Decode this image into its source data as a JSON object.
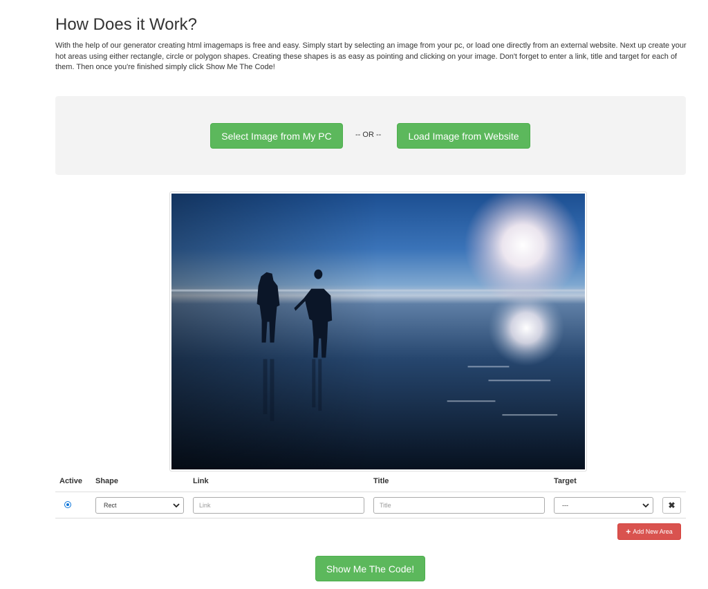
{
  "header": {
    "title": "How Does it Work?",
    "intro": "With the help of our generator creating html imagemaps is free and easy. Simply start by selecting an image from your pc, or load one directly from an external website. Next up create your hot areas using either rectangle, circle or polygon shapes. Creating these shapes is as easy as pointing and clicking on your image. Don't forget to enter a link, title and target for each of them. Then once you're finished simply click Show Me The Code!"
  },
  "upload": {
    "select_label": "Select Image from My PC",
    "or_label": "-- OR --",
    "load_label": "Load Image from Website"
  },
  "areas_table": {
    "headers": {
      "active": "Active",
      "shape": "Shape",
      "link": "Link",
      "title": "Title",
      "target": "Target"
    },
    "rows": [
      {
        "active": true,
        "shape": "Rect",
        "link_placeholder": "Link",
        "title_placeholder": "Title",
        "target": "---",
        "remove_icon": "✖"
      }
    ],
    "add_label": "Add New Area",
    "add_icon": "+"
  },
  "actions": {
    "show_code_label": "Show Me The Code!"
  },
  "colors": {
    "success": "#5cb85c",
    "danger": "#d9534f",
    "panel": "#f3f3f3"
  }
}
